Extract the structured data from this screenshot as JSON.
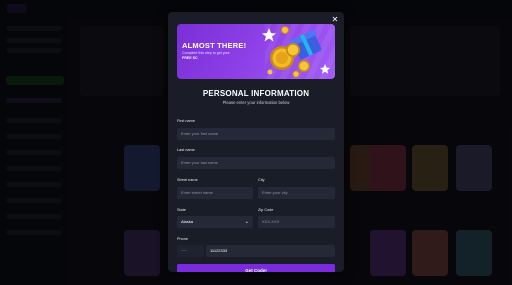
{
  "modal": {
    "close_glyph": "✕",
    "banner": {
      "title": "ALMOST THERE!",
      "subtitle": "Complete this step to get your",
      "subtitle_bold": "FREE SC",
      "art_icon": "gold-coins-gift-icon"
    },
    "form": {
      "title": "PERSONAL INFORMATION",
      "subtitle": "Please enter your information below",
      "first_name": {
        "label": "First name",
        "placeholder": "Enter your first name"
      },
      "last_name": {
        "label": "Last name",
        "placeholder": "Enter your last name"
      },
      "street_name": {
        "label": "Street name",
        "placeholder": "Enter street name"
      },
      "city": {
        "label": "City",
        "placeholder": "Enter your city"
      },
      "state": {
        "label": "State",
        "value": "Alaska",
        "chevron": "⌄"
      },
      "zip": {
        "label": "Zip Code",
        "placeholder": "XXX-XXX"
      },
      "phone": {
        "label": "Phone",
        "value": "11122333"
      },
      "submit_label": "Get Code!"
    }
  },
  "colors": {
    "accent": "#7a2bdc",
    "banner": "#8d3fe6",
    "panel": "#1a1c27",
    "input": "#252836"
  }
}
